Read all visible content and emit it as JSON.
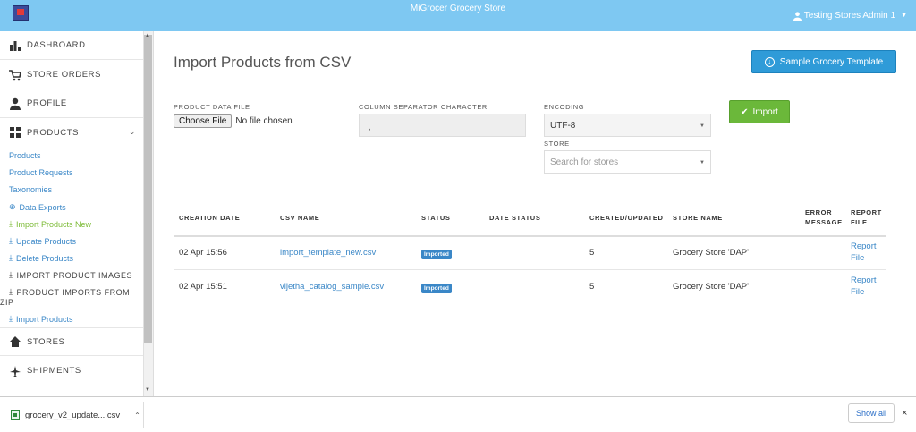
{
  "app": {
    "title": "MiGrocer Grocery Store",
    "user": "Testing Stores Admin 1"
  },
  "sidebar": {
    "main": [
      {
        "label": "DASHBOARD",
        "icon": "bar-chart-icon"
      },
      {
        "label": "STORE ORDERS",
        "icon": "cart-icon"
      },
      {
        "label": "PROFILE",
        "icon": "user-icon"
      },
      {
        "label": "PRODUCTS",
        "icon": "grid-icon"
      }
    ],
    "sub": [
      {
        "label": "Products"
      },
      {
        "label": "Product Requests"
      },
      {
        "label": "Taxonomies"
      },
      {
        "label": "Data Exports",
        "icon": "circle-arrow-icon"
      },
      {
        "label": "Import Products New",
        "icon": "import-icon"
      },
      {
        "label": "Update Products",
        "icon": "import-icon"
      },
      {
        "label": "Delete Products",
        "icon": "import-icon"
      },
      {
        "label": "IMPORT PRODUCT IMAGES",
        "icon": "import-icon"
      },
      {
        "label": "PRODUCT IMPORTS FROM",
        "label2": "ZIP",
        "icon": "import-icon"
      },
      {
        "label": "Import Products",
        "icon": "import-icon"
      }
    ],
    "bottom": [
      {
        "label": "STORES",
        "icon": "home-icon"
      },
      {
        "label": "SHIPMENTS",
        "icon": "plane-icon"
      }
    ]
  },
  "page": {
    "title": "Import Products from CSV",
    "sample_button": "Sample Grocery Template",
    "form": {
      "file_label": "PRODUCT DATA FILE",
      "choose_button": "Choose File",
      "file_status": "No file chosen",
      "separator_label": "COLUMN SEPARATOR CHARACTER",
      "separator_value": ",",
      "encoding_label": "ENCODING",
      "encoding_value": "UTF-8",
      "store_label": "STORE",
      "store_placeholder": "Search for stores",
      "import_button": "Import"
    },
    "table": {
      "headers": [
        "CREATION DATE",
        "CSV NAME",
        "STATUS",
        "DATE STATUS",
        "CREATED/UPDATED",
        "STORE NAME",
        "ERROR",
        "MESSAGE",
        "REPORT",
        "FILE"
      ],
      "rows": [
        {
          "date": "02 Apr 15:56",
          "csv": "import_template_new.csv",
          "status": "Imported",
          "count": "5",
          "store": "Grocery Store 'DAP'",
          "report1": "Report",
          "report2": "File"
        },
        {
          "date": "02 Apr 15:51",
          "csv": "vijetha_catalog_sample.csv",
          "status": "Imported",
          "count": "5",
          "store": "Grocery Store 'DAP'",
          "report1": "Report",
          "report2": "File"
        }
      ]
    }
  },
  "download_bar": {
    "file": "grocery_v2_update....csv",
    "show_all": "Show all",
    "close": "×"
  }
}
